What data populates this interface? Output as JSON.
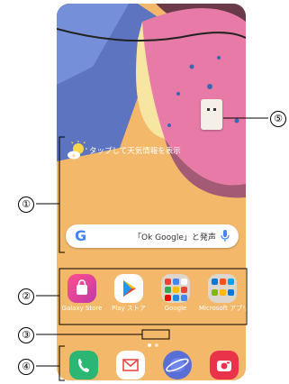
{
  "weather": {
    "text": "タップして天気情報を表示"
  },
  "search": {
    "placeholder": "「Ok Google」と発声"
  },
  "apps": [
    {
      "label": "Galaxy Store"
    },
    {
      "label": "Play ストア"
    },
    {
      "label": "Google"
    },
    {
      "label": "Microsoft アプリ"
    }
  ],
  "pager": {
    "pages": 2,
    "current": 1
  },
  "callouts": {
    "c1": "①",
    "c2": "②",
    "c3": "③",
    "c4": "④",
    "c5": "⑤"
  },
  "colors": {
    "accent": "#4285f4",
    "wallpaper_orange": "#f2b66a",
    "wallpaper_pink": "#e87aa7"
  }
}
